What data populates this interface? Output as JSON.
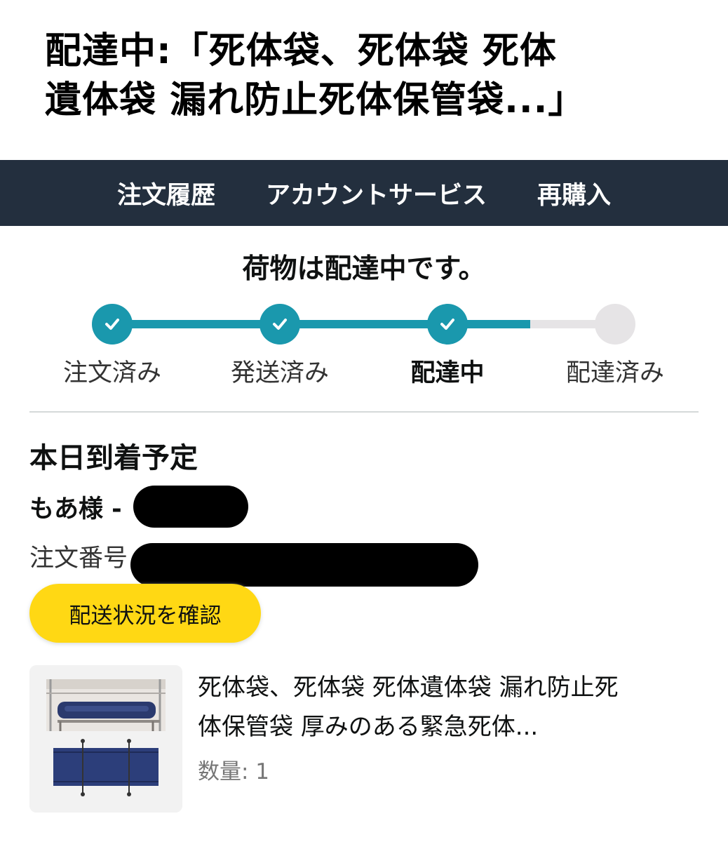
{
  "headline": {
    "line1": "配達中:「死体袋、死体袋 死体",
    "line2": "遺体袋 漏れ防止死体保管袋...」"
  },
  "nav": {
    "items": [
      "注文履歴",
      "アカウントサービス",
      "再購入"
    ]
  },
  "status": {
    "title": "荷物は配達中です。",
    "progress_fraction": 0.83,
    "steps": [
      {
        "label": "注文済み",
        "done": true
      },
      {
        "label": "発送済み",
        "done": true
      },
      {
        "label": "配達中",
        "done": true,
        "current": true
      },
      {
        "label": "配達済み",
        "done": false
      }
    ]
  },
  "order": {
    "arrival": "本日到着予定",
    "recipient_label": "もあ様 -",
    "order_number_label": "注文番号",
    "track_button": "配送状況を確認"
  },
  "product": {
    "title_line1": "死体袋、死体袋 死体遺体袋 漏れ防止死",
    "title_line2": "体保管袋 厚みのある緊急死体...",
    "quantity": "数量: 1"
  },
  "colors": {
    "nav_bg": "#232f3e",
    "progress_active": "#1a98ad",
    "progress_inactive": "#e6e4e6",
    "button_bg": "#ffd814"
  }
}
